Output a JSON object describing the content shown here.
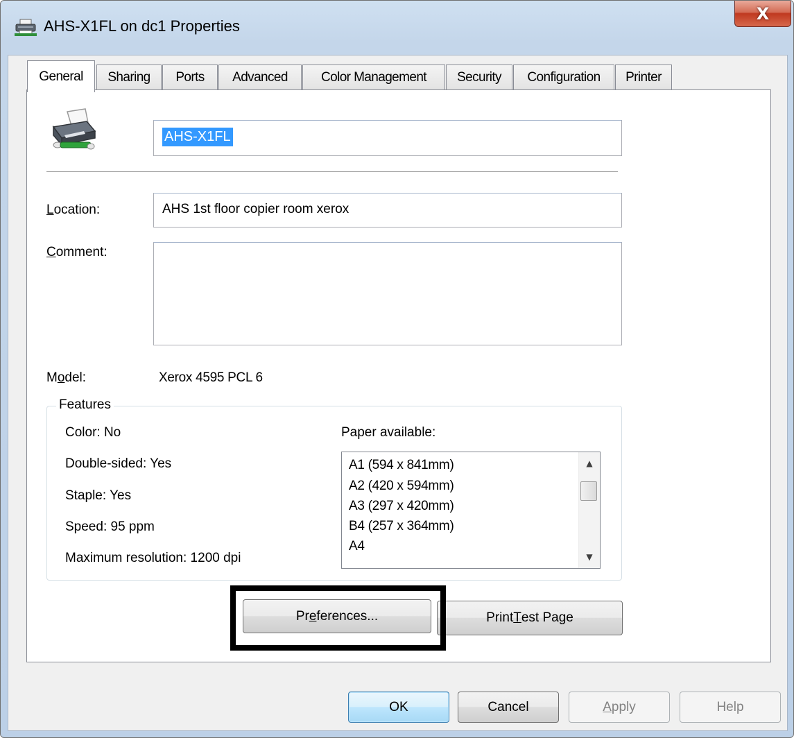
{
  "window": {
    "title": "AHS-X1FL on dc1 Properties",
    "close_label": "X",
    "icon": "printer-icon"
  },
  "tabs": [
    {
      "label": "General",
      "active": true
    },
    {
      "label": "Sharing",
      "active": false
    },
    {
      "label": "Ports",
      "active": false
    },
    {
      "label": "Advanced",
      "active": false
    },
    {
      "label": "Color Management",
      "active": false
    },
    {
      "label": "Security",
      "active": false
    },
    {
      "label": "Configuration",
      "active": false
    },
    {
      "label": "Printer",
      "active": false
    }
  ],
  "general": {
    "printer_name": "AHS-X1FL",
    "location": {
      "label_hotkey": "L",
      "label_rest": "ocation:",
      "value": "AHS 1st floor copier room xerox"
    },
    "comment": {
      "label_hotkey": "C",
      "label_rest": "omment:",
      "value": ""
    },
    "model": {
      "label_pre": "M",
      "label_hotkey": "o",
      "label_rest": "del:",
      "value": "Xerox 4595 PCL 6"
    },
    "features": {
      "title": "Features",
      "color": "Color: No",
      "double_sided": "Double-sided: Yes",
      "staple": "Staple: Yes",
      "speed": "Speed: 95 ppm",
      "max_resolution": "Maximum resolution: 1200 dpi",
      "paper_label": "Paper available:",
      "paper": [
        "A1 (594 x 841mm)",
        "A2 (420 x 594mm)",
        "A3 (297 x 420mm)",
        "B4 (257 x 364mm)",
        "A4"
      ]
    },
    "preferences": {
      "pre": "Pr",
      "hotkey": "e",
      "rest": "ferences..."
    },
    "print_test": {
      "pre": "Print ",
      "hotkey": "T",
      "rest": "est Page"
    }
  },
  "buttons": {
    "ok": "OK",
    "cancel": "Cancel",
    "apply_hotkey": "A",
    "apply_rest": "pply",
    "help": "Help"
  },
  "colors": {
    "selection": "#3399ff",
    "close_button": "#c0391f",
    "annotation_box": "#000000"
  }
}
